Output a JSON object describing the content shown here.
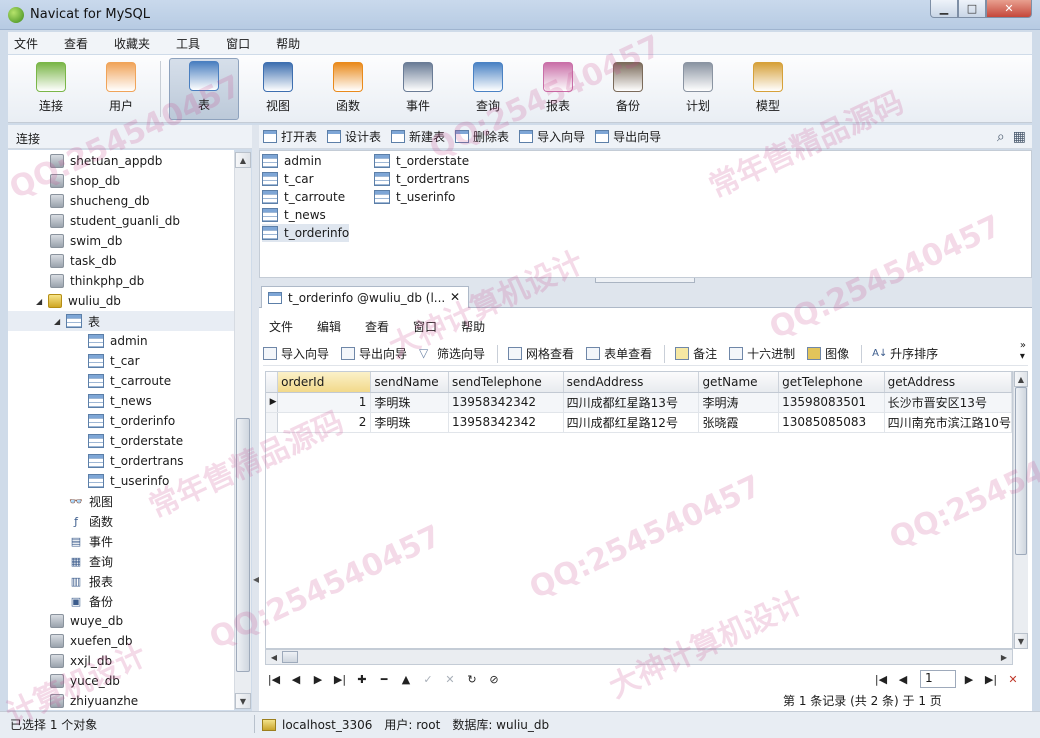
{
  "window": {
    "title": "Navicat for MySQL"
  },
  "menu": [
    "文件",
    "查看",
    "收藏夹",
    "工具",
    "窗口",
    "帮助"
  ],
  "toolbar": [
    {
      "label": "连接",
      "icon": "connection-icon",
      "color": "#7ab648"
    },
    {
      "label": "用户",
      "icon": "user-icon",
      "color": "#f0a45a"
    },
    {
      "label": "表",
      "icon": "table-icon",
      "color": "#4a7fc0",
      "active": true
    },
    {
      "label": "视图",
      "icon": "view-icon",
      "color": "#3e6fb0"
    },
    {
      "label": "函数",
      "icon": "function-icon",
      "color": "#e98a1c"
    },
    {
      "label": "事件",
      "icon": "event-icon",
      "color": "#6a7c96"
    },
    {
      "label": "查询",
      "icon": "query-icon",
      "color": "#4a82c4"
    },
    {
      "label": "报表",
      "icon": "report-icon",
      "color": "#c96fa8"
    },
    {
      "label": "备份",
      "icon": "backup-icon",
      "color": "#7b6b5b"
    },
    {
      "label": "计划",
      "icon": "schedule-icon",
      "color": "#8a94a2"
    },
    {
      "label": "模型",
      "icon": "model-icon",
      "color": "#d6a13a"
    }
  ],
  "left": {
    "header": "连接",
    "databases_before": [
      "shetuan_appdb",
      "shop_db",
      "shucheng_db",
      "student_guanli_db",
      "swim_db",
      "task_db",
      "thinkphp_db"
    ],
    "open_db": "wuliu_db",
    "tables_label": "表",
    "tables": [
      "admin",
      "t_car",
      "t_carroute",
      "t_news",
      "t_orderinfo",
      "t_orderstate",
      "t_ordertrans",
      "t_userinfo"
    ],
    "objects": [
      "视图",
      "函数",
      "事件",
      "查询",
      "报表",
      "备份"
    ],
    "databases_after": [
      "wuye_db",
      "xuefen_db",
      "xxjl_db",
      "yuce_db",
      "zhiyuanzhe"
    ]
  },
  "object_toolbar": [
    "打开表",
    "设计表",
    "新建表",
    "删除表",
    "导入向导",
    "导出向导"
  ],
  "object_list": {
    "col1": [
      "admin",
      "t_car",
      "t_carroute",
      "t_news",
      "t_orderinfo"
    ],
    "col2": [
      "t_orderstate",
      "t_ordertrans",
      "t_userinfo"
    ]
  },
  "tab": {
    "label": "t_orderinfo @wuliu_db (l...",
    "close": "✕"
  },
  "doc_menu": [
    "文件",
    "编辑",
    "查看",
    "窗口",
    "帮助"
  ],
  "doc_tools": [
    "导入向导",
    "导出向导",
    "筛选向导",
    "网格查看",
    "表单查看",
    "备注",
    "十六进制",
    "图像",
    "升序排序"
  ],
  "grid": {
    "columns": [
      "orderId",
      "sendName",
      "sendTelephone",
      "sendAddress",
      "getName",
      "getTelephone",
      "getAddress"
    ],
    "rows": [
      [
        "1",
        "李明珠",
        "13958342342",
        "四川成都红星路13号",
        "李明涛",
        "13598083501",
        "长沙市晋安区13号"
      ],
      [
        "2",
        "李明珠",
        "13958342342",
        "四川成都红星路12号",
        "张晓霞",
        "13085085083",
        "四川南充市滨江路10号"
      ]
    ]
  },
  "nav": {
    "page": "1",
    "record_info": "第 1 条记录 (共 2 条) 于 1 页"
  },
  "status": {
    "selection": "已选择 1 个对象",
    "connection": "localhost_3306",
    "user": "用户: root",
    "database": "数据库: wuliu_db"
  },
  "watermark": {
    "qq": "QQ:254540457",
    "a": "大神计算机设计",
    "b": "常年售精品源码",
    "c": "计算机设计"
  }
}
